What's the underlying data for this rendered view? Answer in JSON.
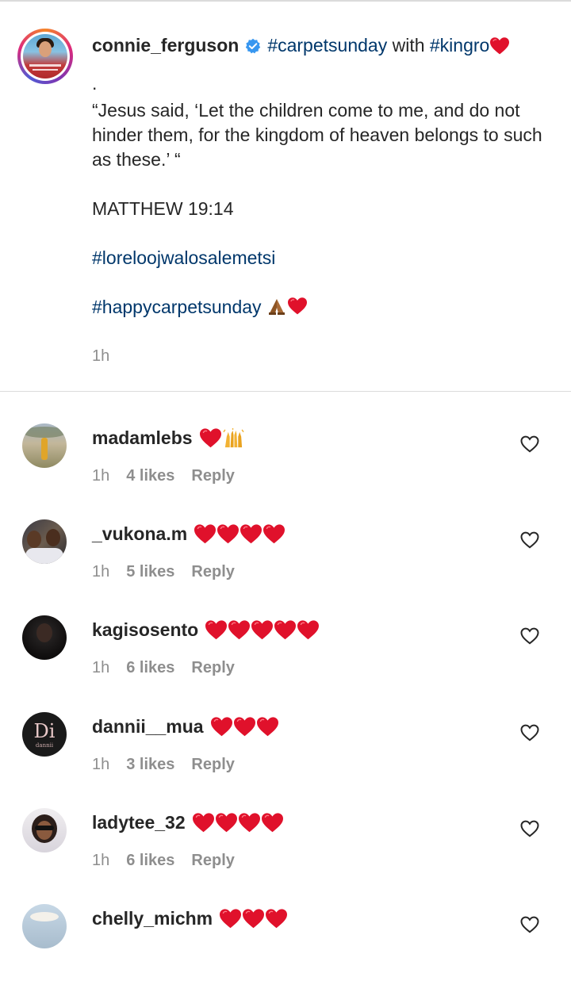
{
  "caption": {
    "username": "connie_ferguson",
    "head_tag_1": "#carpetsunday",
    "head_with": " with ",
    "head_tag_2": "#kingro",
    "dot": ".",
    "quote": "“Jesus said, ‘Let the children come to me, and do not hinder them, for the kingdom of heaven belongs to such as these.’ “",
    "reference": "MATTHEW 19:14",
    "tag_3": "#loreloojwalosalemetsi",
    "tag_4": "#happycarpetsunday",
    "time": "1h"
  },
  "comments": [
    {
      "username": "madamlebs",
      "emojis": "heart, raising-hands",
      "time": "1h",
      "likes": "4 likes",
      "reply": "Reply"
    },
    {
      "username": "_vukona.m",
      "emojis": "heart x4",
      "time": "1h",
      "likes": "5 likes",
      "reply": "Reply"
    },
    {
      "username": "kagisosento",
      "emojis": "heart x5",
      "time": "1h",
      "likes": "6 likes",
      "reply": "Reply"
    },
    {
      "username": "dannii__mua",
      "emojis": "heart x3",
      "time": "1h",
      "likes": "3 likes",
      "reply": "Reply"
    },
    {
      "username": "ladytee_32",
      "emojis": "heart x4",
      "time": "1h",
      "likes": "6 likes",
      "reply": "Reply"
    },
    {
      "username": "chelly_michm",
      "emojis": "heart x3"
    }
  ],
  "avatar_text": {
    "dannii_logo": "Di",
    "dannii_sub": "dannii"
  },
  "colors": {
    "hashtag": "#00376b",
    "meta": "#8e8e8e",
    "heart": "#e0112b",
    "verified": "#3897f0"
  },
  "icons": {
    "verified": "verified-badge-icon",
    "like": "heart-outline-icon",
    "heart_emoji": "red-heart-emoji",
    "pray_emoji": "folded-hands-emoji",
    "raise_emoji": "raising-hands-emoji"
  }
}
